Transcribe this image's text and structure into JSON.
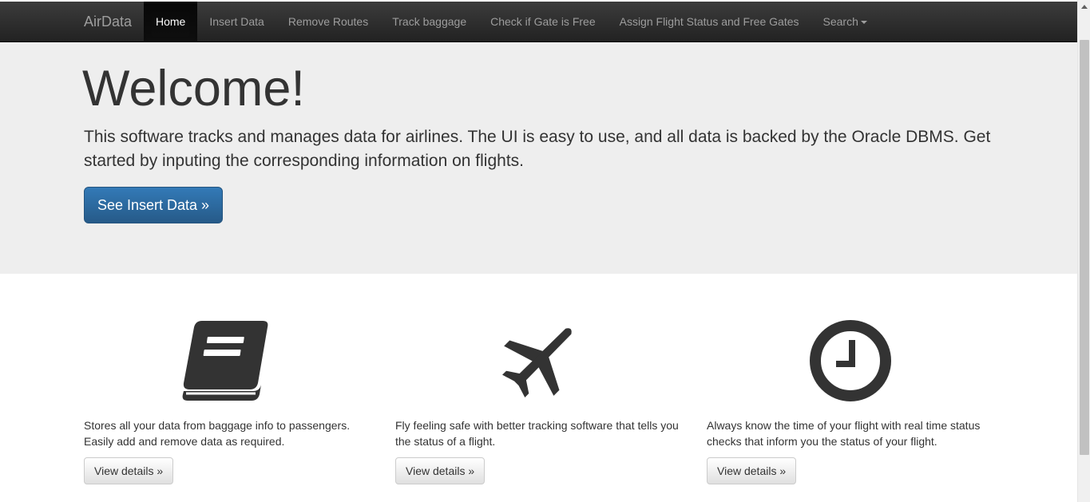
{
  "navbar": {
    "brand": "AirData",
    "items": [
      {
        "label": "Home",
        "active": true
      },
      {
        "label": "Insert Data"
      },
      {
        "label": "Remove Routes"
      },
      {
        "label": "Track baggage"
      },
      {
        "label": "Check if Gate is Free"
      },
      {
        "label": "Assign Flight Status and Free Gates"
      },
      {
        "label": "Search"
      }
    ]
  },
  "jumbotron": {
    "heading": "Welcome!",
    "text": "This software tracks and manages data for airlines. The UI is easy to use, and all data is backed by the Oracle DBMS. Get started by inputing the corresponding information on flights.",
    "button_label": "See Insert Data »"
  },
  "features": [
    {
      "icon": "book-icon",
      "text": "Stores all your data from baggage info to passengers. Easily add and remove data as required.",
      "button_label": "View details »"
    },
    {
      "icon": "airplane-icon",
      "text": "Fly feeling safe with better tracking software that tells you the status of a flight.",
      "button_label": "View details »"
    },
    {
      "icon": "clock-icon",
      "text": "Always know the time of your flight with real time status checks that inform you the status of your flight.",
      "button_label": "View details »"
    }
  ],
  "colors": {
    "navbar": "#222222",
    "jumbotron_bg": "#eeeeee",
    "primary": "#337ab7",
    "icon": "#333333"
  }
}
